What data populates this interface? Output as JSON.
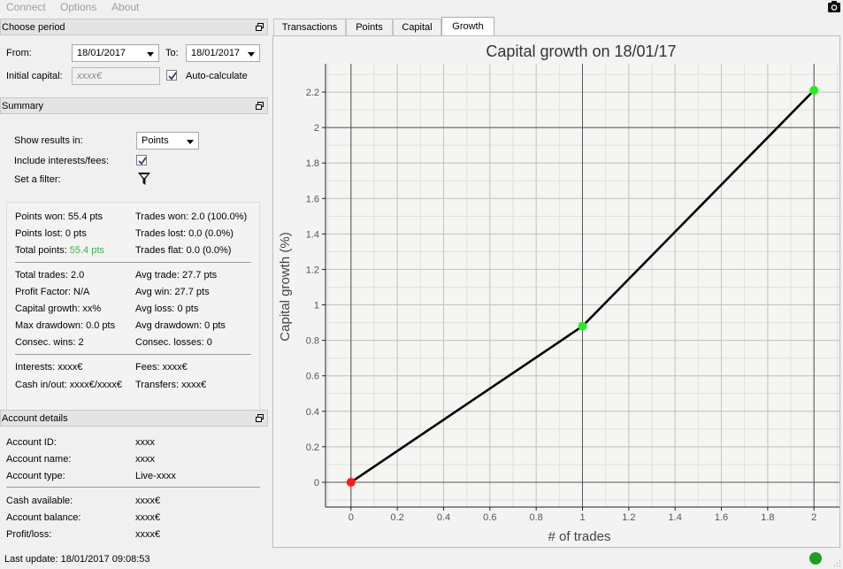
{
  "menu": {
    "connect": "Connect",
    "options": "Options",
    "about": "About"
  },
  "choose_period": {
    "title": "Choose period",
    "from_label": "From:",
    "from_value": "18/01/2017",
    "to_label": "To:",
    "to_value": "18/01/2017",
    "initial_capital_label": "Initial capital:",
    "initial_capital_placeholder": "xxxx€",
    "auto_calculate_label": "Auto-calculate",
    "auto_calculate_checked": true
  },
  "summary": {
    "title": "Summary",
    "show_results_label": "Show results in:",
    "show_results_value": "Points",
    "include_label": "Include interests/fees:",
    "include_checked": true,
    "filter_label": "Set a filter:",
    "stats": {
      "points_won": "Points won: 55.4 pts",
      "points_lost": "Points lost: 0 pts",
      "total_points_label": "Total points:",
      "total_points_value": "55.4 pts",
      "trades_won": "Trades won: 2.0 (100.0%)",
      "trades_lost": "Trades lost: 0.0 (0.0%)",
      "trades_flat": "Trades flat: 0.0 (0.0%)",
      "total_trades": "Total trades: 2.0",
      "profit_factor": "Profit Factor: N/A",
      "capital_growth": "Capital growth: xx%",
      "max_drawdown": "Max drawdown: 0.0 pts",
      "consec_wins": "Consec. wins: 2",
      "avg_trade": "Avg trade: 27.7 pts",
      "avg_win": "Avg win: 27.7 pts",
      "avg_loss": "Avg loss: 0 pts",
      "avg_drawdown": "Avg drawdown: 0 pts",
      "consec_losses": "Consec. losses: 0",
      "interests": "Interests: xxxx€",
      "cash_in_out": "Cash in/out: xxxx€/xxxx€",
      "fees": "Fees: xxxx€",
      "transfers": "Transfers: xxxx€"
    }
  },
  "account": {
    "title": "Account details",
    "id_label": "Account ID:",
    "id_value": "xxxx",
    "name_label": "Account name:",
    "name_value": "xxxx",
    "type_label": "Account type:",
    "type_value": "Live-xxxx",
    "cash_label": "Cash available:",
    "cash_value": "xxxx€",
    "balance_label": "Account balance:",
    "balance_value": "xxxx€",
    "pl_label": "Profit/loss:",
    "pl_value": "xxxx€"
  },
  "tabs": [
    "Transactions",
    "Points",
    "Capital",
    "Growth"
  ],
  "active_tab": "Growth",
  "status": {
    "last_update": "Last update: 18/01/2017 09:08:53",
    "connection_color": "#1ea01e"
  },
  "chart_data": {
    "type": "line",
    "title": "Capital growth on 18/01/17",
    "xlabel": "# of trades",
    "ylabel": "Capital growth (%)",
    "x": [
      0,
      1,
      2
    ],
    "y": [
      0,
      0.88,
      2.21
    ],
    "point_colors": [
      "#ff1a1a",
      "#22ee22",
      "#22ee22"
    ],
    "line_color": "#000000",
    "xlim": [
      -0.11,
      2.11
    ],
    "ylim": [
      -0.14,
      2.36
    ],
    "xticks": [
      "0",
      "0.2",
      "0.4",
      "0.6",
      "0.8",
      "1",
      "1.2",
      "1.4",
      "1.6",
      "1.8",
      "2"
    ],
    "yticks": [
      "0",
      "0.2",
      "0.4",
      "0.6",
      "0.8",
      "1",
      "1.2",
      "1.4",
      "1.6",
      "1.8",
      "2",
      "2.2"
    ],
    "grid": true
  }
}
